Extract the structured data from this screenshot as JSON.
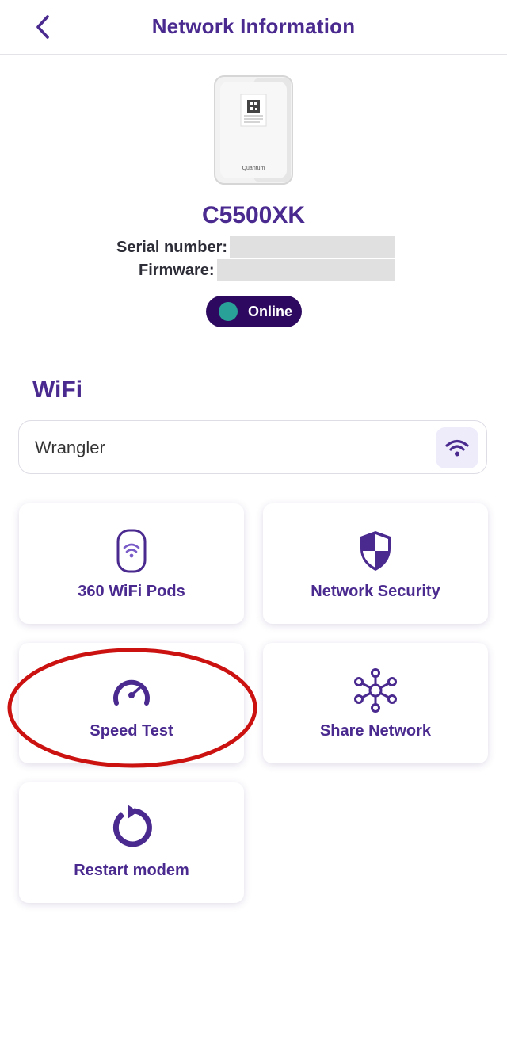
{
  "header": {
    "title": "Network Information"
  },
  "device": {
    "model": "C5500XK",
    "serial_label": "Serial number:",
    "firmware_label": "Firmware:",
    "status": "Online",
    "image_brand": "Quantum"
  },
  "wifi": {
    "section_title": "WiFi",
    "network_name": "Wrangler"
  },
  "tiles": [
    {
      "label": "360 WiFi Pods",
      "icon": "wifi-pod-icon"
    },
    {
      "label": "Network Security",
      "icon": "shield-icon"
    },
    {
      "label": "Speed Test",
      "icon": "speedometer-icon"
    },
    {
      "label": "Share Network",
      "icon": "network-nodes-icon"
    },
    {
      "label": "Restart modem",
      "icon": "restart-icon"
    }
  ],
  "colors": {
    "accent": "#4a2a8f",
    "status_pill": "#2d0a5f",
    "status_dot": "#2aa198",
    "highlight": "#cc1111"
  }
}
